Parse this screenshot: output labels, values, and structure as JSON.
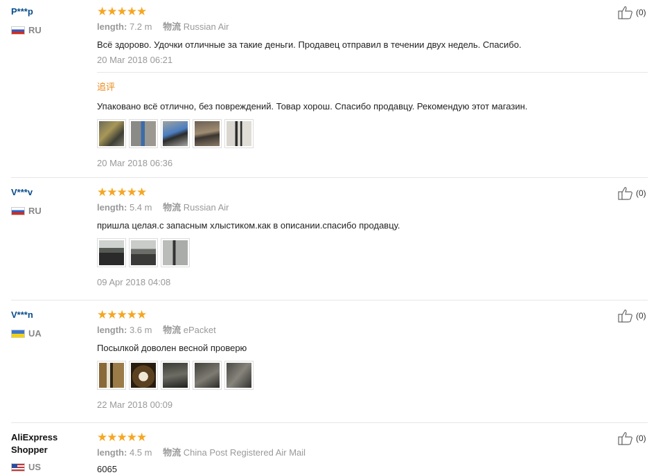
{
  "reviews": [
    {
      "name": "P***p",
      "country": "RU",
      "stars": "★★★★★",
      "length_label": "length:",
      "length_value": "7.2 m",
      "shipping_label": "物流",
      "shipping_value": "Russian Air",
      "text": "Всё здорово. Удочки отличные за такие деньги. Продавец отправил в течении двух недель. Спасибо.",
      "date": "20 Mar 2018 06:21",
      "helpful": "(0)",
      "followup": {
        "label": "追评",
        "text": "Упаковано всё отлично, без повреждений. Товар хорош. Спасибо продавцу. Рекомендую этот магазин.",
        "date": "20 Mar 2018 06:36"
      }
    },
    {
      "name": "V***v",
      "country": "RU",
      "stars": "★★★★★",
      "length_label": "length:",
      "length_value": "5.4 m",
      "shipping_label": "物流",
      "shipping_value": "Russian Air",
      "text": "пришла целая.с запасным хлыстиком.как в описании.спасибо продавцу.",
      "date": "09 Apr 2018 04:08",
      "helpful": "(0)"
    },
    {
      "name": "V***n",
      "country": "UA",
      "stars": "★★★★★",
      "length_label": "length:",
      "length_value": "3.6 m",
      "shipping_label": "物流",
      "shipping_value": "ePacket",
      "text": "Посылкой доволен весной проверю",
      "date": "22 Mar 2018 00:09",
      "helpful": "(0)"
    },
    {
      "name": "AliExpress Shopper",
      "country": "US",
      "stars": "★★★★★",
      "length_label": "length:",
      "length_value": "4.5 m",
      "shipping_label": "物流",
      "shipping_value": "China Post Registered Air Mail",
      "text": "6065",
      "helpful": "(0)"
    }
  ],
  "colors": {
    "star": "#f5a623",
    "username": "#0a4d8c",
    "followup_label": "#e88a1a",
    "muted": "#999999"
  }
}
